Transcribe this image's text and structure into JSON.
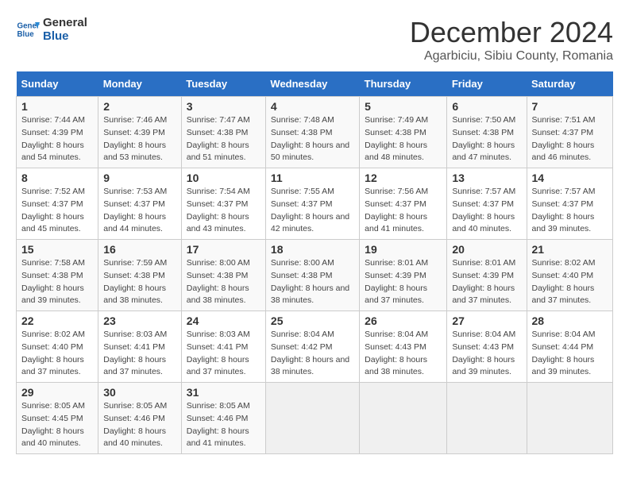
{
  "logo": {
    "line1": "General",
    "line2": "Blue"
  },
  "title": "December 2024",
  "subtitle": "Agarbiciu, Sibiu County, Romania",
  "days_of_week": [
    "Sunday",
    "Monday",
    "Tuesday",
    "Wednesday",
    "Thursday",
    "Friday",
    "Saturday"
  ],
  "weeks": [
    [
      {
        "day": "1",
        "sunrise": "Sunrise: 7:44 AM",
        "sunset": "Sunset: 4:39 PM",
        "daylight": "Daylight: 8 hours and 54 minutes."
      },
      {
        "day": "2",
        "sunrise": "Sunrise: 7:46 AM",
        "sunset": "Sunset: 4:39 PM",
        "daylight": "Daylight: 8 hours and 53 minutes."
      },
      {
        "day": "3",
        "sunrise": "Sunrise: 7:47 AM",
        "sunset": "Sunset: 4:38 PM",
        "daylight": "Daylight: 8 hours and 51 minutes."
      },
      {
        "day": "4",
        "sunrise": "Sunrise: 7:48 AM",
        "sunset": "Sunset: 4:38 PM",
        "daylight": "Daylight: 8 hours and 50 minutes."
      },
      {
        "day": "5",
        "sunrise": "Sunrise: 7:49 AM",
        "sunset": "Sunset: 4:38 PM",
        "daylight": "Daylight: 8 hours and 48 minutes."
      },
      {
        "day": "6",
        "sunrise": "Sunrise: 7:50 AM",
        "sunset": "Sunset: 4:38 PM",
        "daylight": "Daylight: 8 hours and 47 minutes."
      },
      {
        "day": "7",
        "sunrise": "Sunrise: 7:51 AM",
        "sunset": "Sunset: 4:37 PM",
        "daylight": "Daylight: 8 hours and 46 minutes."
      }
    ],
    [
      {
        "day": "8",
        "sunrise": "Sunrise: 7:52 AM",
        "sunset": "Sunset: 4:37 PM",
        "daylight": "Daylight: 8 hours and 45 minutes."
      },
      {
        "day": "9",
        "sunrise": "Sunrise: 7:53 AM",
        "sunset": "Sunset: 4:37 PM",
        "daylight": "Daylight: 8 hours and 44 minutes."
      },
      {
        "day": "10",
        "sunrise": "Sunrise: 7:54 AM",
        "sunset": "Sunset: 4:37 PM",
        "daylight": "Daylight: 8 hours and 43 minutes."
      },
      {
        "day": "11",
        "sunrise": "Sunrise: 7:55 AM",
        "sunset": "Sunset: 4:37 PM",
        "daylight": "Daylight: 8 hours and 42 minutes."
      },
      {
        "day": "12",
        "sunrise": "Sunrise: 7:56 AM",
        "sunset": "Sunset: 4:37 PM",
        "daylight": "Daylight: 8 hours and 41 minutes."
      },
      {
        "day": "13",
        "sunrise": "Sunrise: 7:57 AM",
        "sunset": "Sunset: 4:37 PM",
        "daylight": "Daylight: 8 hours and 40 minutes."
      },
      {
        "day": "14",
        "sunrise": "Sunrise: 7:57 AM",
        "sunset": "Sunset: 4:37 PM",
        "daylight": "Daylight: 8 hours and 39 minutes."
      }
    ],
    [
      {
        "day": "15",
        "sunrise": "Sunrise: 7:58 AM",
        "sunset": "Sunset: 4:38 PM",
        "daylight": "Daylight: 8 hours and 39 minutes."
      },
      {
        "day": "16",
        "sunrise": "Sunrise: 7:59 AM",
        "sunset": "Sunset: 4:38 PM",
        "daylight": "Daylight: 8 hours and 38 minutes."
      },
      {
        "day": "17",
        "sunrise": "Sunrise: 8:00 AM",
        "sunset": "Sunset: 4:38 PM",
        "daylight": "Daylight: 8 hours and 38 minutes."
      },
      {
        "day": "18",
        "sunrise": "Sunrise: 8:00 AM",
        "sunset": "Sunset: 4:38 PM",
        "daylight": "Daylight: 8 hours and 38 minutes."
      },
      {
        "day": "19",
        "sunrise": "Sunrise: 8:01 AM",
        "sunset": "Sunset: 4:39 PM",
        "daylight": "Daylight: 8 hours and 37 minutes."
      },
      {
        "day": "20",
        "sunrise": "Sunrise: 8:01 AM",
        "sunset": "Sunset: 4:39 PM",
        "daylight": "Daylight: 8 hours and 37 minutes."
      },
      {
        "day": "21",
        "sunrise": "Sunrise: 8:02 AM",
        "sunset": "Sunset: 4:40 PM",
        "daylight": "Daylight: 8 hours and 37 minutes."
      }
    ],
    [
      {
        "day": "22",
        "sunrise": "Sunrise: 8:02 AM",
        "sunset": "Sunset: 4:40 PM",
        "daylight": "Daylight: 8 hours and 37 minutes."
      },
      {
        "day": "23",
        "sunrise": "Sunrise: 8:03 AM",
        "sunset": "Sunset: 4:41 PM",
        "daylight": "Daylight: 8 hours and 37 minutes."
      },
      {
        "day": "24",
        "sunrise": "Sunrise: 8:03 AM",
        "sunset": "Sunset: 4:41 PM",
        "daylight": "Daylight: 8 hours and 37 minutes."
      },
      {
        "day": "25",
        "sunrise": "Sunrise: 8:04 AM",
        "sunset": "Sunset: 4:42 PM",
        "daylight": "Daylight: 8 hours and 38 minutes."
      },
      {
        "day": "26",
        "sunrise": "Sunrise: 8:04 AM",
        "sunset": "Sunset: 4:43 PM",
        "daylight": "Daylight: 8 hours and 38 minutes."
      },
      {
        "day": "27",
        "sunrise": "Sunrise: 8:04 AM",
        "sunset": "Sunset: 4:43 PM",
        "daylight": "Daylight: 8 hours and 39 minutes."
      },
      {
        "day": "28",
        "sunrise": "Sunrise: 8:04 AM",
        "sunset": "Sunset: 4:44 PM",
        "daylight": "Daylight: 8 hours and 39 minutes."
      }
    ],
    [
      {
        "day": "29",
        "sunrise": "Sunrise: 8:05 AM",
        "sunset": "Sunset: 4:45 PM",
        "daylight": "Daylight: 8 hours and 40 minutes."
      },
      {
        "day": "30",
        "sunrise": "Sunrise: 8:05 AM",
        "sunset": "Sunset: 4:46 PM",
        "daylight": "Daylight: 8 hours and 40 minutes."
      },
      {
        "day": "31",
        "sunrise": "Sunrise: 8:05 AM",
        "sunset": "Sunset: 4:46 PM",
        "daylight": "Daylight: 8 hours and 41 minutes."
      },
      null,
      null,
      null,
      null
    ]
  ]
}
